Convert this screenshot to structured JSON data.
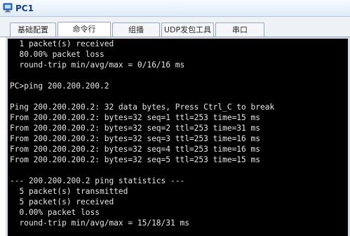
{
  "window": {
    "title": "PC1",
    "icon": "pc-icon"
  },
  "tabs": [
    {
      "label": "基础配置"
    },
    {
      "label": "命令行"
    },
    {
      "label": "组播"
    },
    {
      "label": "UDP发包工具"
    },
    {
      "label": "串口"
    }
  ],
  "console": {
    "lines": [
      "  1 packet(s) received",
      "  80.00% packet loss",
      "  round-trip min/avg/max = 0/16/16 ms",
      "",
      "PC>ping 200.200.200.2",
      "",
      "Ping 200.200.200.2: 32 data bytes, Press Ctrl_C to break",
      "From 200.200.200.2: bytes=32 seq=1 ttl=253 time=15 ms",
      "From 200.200.200.2: bytes=32 seq=2 ttl=253 time=31 ms",
      "From 200.200.200.2: bytes=32 seq=3 ttl=253 time=16 ms",
      "From 200.200.200.2: bytes=32 seq=4 ttl=253 time=16 ms",
      "From 200.200.200.2: bytes=32 seq=5 ttl=253 time=15 ms",
      "",
      "--- 200.200.200.2 ping statistics ---",
      "  5 packet(s) transmitted",
      "  5 packet(s) received",
      "  0.00% packet loss",
      "  round-trip min/avg/max = 15/18/31 ms"
    ]
  }
}
